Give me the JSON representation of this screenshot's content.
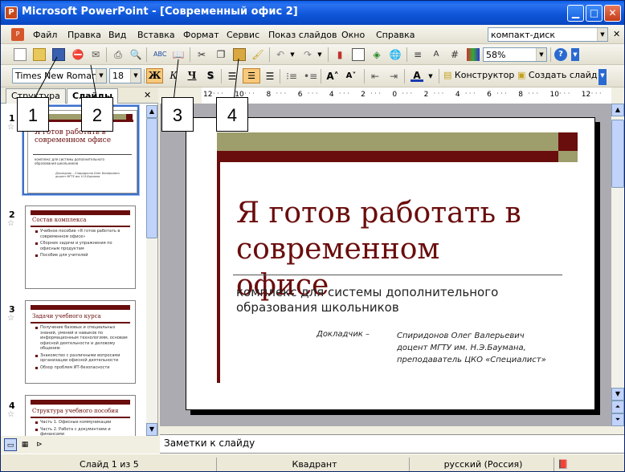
{
  "window": {
    "title": "Microsoft PowerPoint - [Современный офис 2]",
    "app_icon": "P"
  },
  "menu": {
    "items": [
      "Файл",
      "Правка",
      "Вид",
      "Вставка",
      "Формат",
      "Сервис",
      "Показ слайдов",
      "Окно",
      "Справка"
    ],
    "help_box": "компакт-диск"
  },
  "toolbar1": {
    "zoom": "58%"
  },
  "toolbar2": {
    "font": "Times New Roman",
    "size": "18",
    "bold": "Ж",
    "italic": "К",
    "underline": "Ч",
    "shadow": "S",
    "designer": "Конструктор",
    "new_slide": "Создать слайд"
  },
  "panel": {
    "tab_outline": "Структура",
    "tab_slides": "Слайды",
    "close_glyph": "✕",
    "slides": [
      {
        "num": "1",
        "title": "Я готов работать в современном офисе",
        "body": [
          "комплекс для системы дополнительного образования школьников"
        ],
        "author": "Докладчик –  Спиридонов Олег Валерьевич доцент МГТУ им. Н.Э.Баумана"
      },
      {
        "num": "2",
        "title": "Состав комплекса",
        "body": [
          "Учебное пособие «Я готов работать в современном офисе»",
          "Сборник задачи и упражнения по офисным продуктам",
          "Пособие для учителей"
        ]
      },
      {
        "num": "3",
        "title": "Задачи учебного курса",
        "body": [
          "Получение базовых и специальных знаний, умений и навыков по информационным технологиям, основам офисной деятельности и деловому общению",
          "Знакомство с различными вопросами организации офисной деятельности",
          "Обзор проблем ИТ-безопасности"
        ]
      },
      {
        "num": "4",
        "title": "Структура учебного пособия",
        "body": [
          "Часть 1. Офисные коммуникации",
          "Часть 2. Работа с документами и финансами"
        ]
      }
    ]
  },
  "slide": {
    "title": "Я готов работать в современном офисе",
    "subtitle": "комплекс для системы дополнительного образования школьников",
    "presenter_label": "Докладчик –",
    "presenter_lines": [
      "Спиридонов Олег Валерьевич",
      "доцент МГТУ им. Н.Э.Баумана,",
      "преподаватель ЦКО «Специалист»"
    ]
  },
  "ruler": {
    "top": [
      "12",
      "10",
      "8",
      "6",
      "4",
      "2",
      "0",
      "2",
      "4",
      "6",
      "8",
      "10",
      "12"
    ]
  },
  "notes": {
    "placeholder": "Заметки к слайду"
  },
  "status": {
    "slide": "Слайд 1 из 5",
    "design": "Квадрант",
    "language": "русский (Россия)"
  },
  "callouts": [
    "1",
    "2",
    "3",
    "4"
  ],
  "colors": {
    "accent": "#6a0d0d",
    "olive": "#9e9d6c",
    "title_bar": "#0a5ce8"
  }
}
